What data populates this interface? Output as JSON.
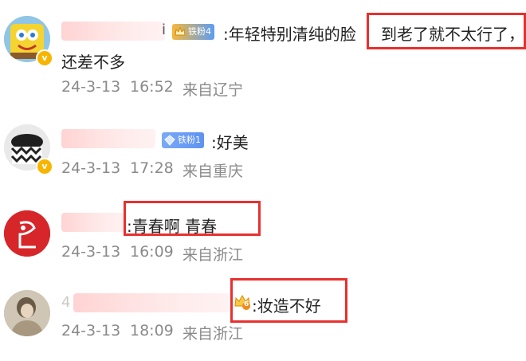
{
  "comments": [
    {
      "badge_label": "铁粉4",
      "text_line1_a": ":年轻特别清纯的脸",
      "text_line1_b": "到老了就不太行了，",
      "text_line2": "还差不多",
      "date": "24-3-13",
      "time": "16:52",
      "location": "来自辽宁",
      "name_hint": "i"
    },
    {
      "badge_label": "铁粉1",
      "text": ":好美",
      "date": "24-3-13",
      "time": "17:28",
      "location": "来自重庆"
    },
    {
      "text": ":青春啊  青春",
      "date": "24-3-13",
      "time": "16:09",
      "location": "来自浙江"
    },
    {
      "name_hint": "4",
      "badge_level": "6",
      "text": ":妆造不好",
      "date": "24-3-13",
      "time": "18:09",
      "location": "来自浙江"
    }
  ],
  "colors": {
    "highlight_box": "#e8302f",
    "meta_text": "#8a8a8a",
    "badge_gold": "#f7b500",
    "badge_blue": "#6b9cf6"
  }
}
